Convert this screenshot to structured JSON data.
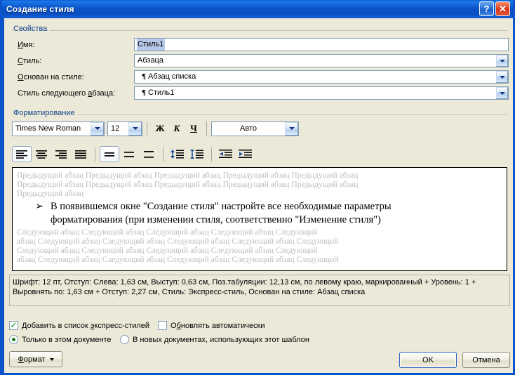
{
  "window": {
    "title": "Создание стиля",
    "help_button": "?",
    "close_button": "✕"
  },
  "properties": {
    "group_label": "Свойства",
    "name_label": "Имя:",
    "name_value": "Стиль1",
    "style_type_label": "Стиль:",
    "style_type_value": "Абзаца",
    "based_on_label": "Основан на стиле:",
    "based_on_value": "Абзац списка",
    "next_style_label": "Стиль следующего абзаца:",
    "next_style_value": "Стиль1",
    "pilcrow": "¶"
  },
  "formatting": {
    "group_label": "Форматирование",
    "font_name": "Times New Roman",
    "font_size": "12",
    "bold_label": "Ж",
    "italic_label": "К",
    "underline_label": "Ч",
    "color_value": "Авто",
    "align_left": "align-left",
    "align_center": "align-center",
    "align_right": "align-right",
    "align_justify": "align-justify",
    "spacing_single": "line-spacing-single",
    "spacing_onehalf": "line-spacing-1.5",
    "spacing_double": "line-spacing-double",
    "space_before": "decrease-paragraph-spacing",
    "space_after": "increase-paragraph-spacing",
    "indent_decrease": "decrease-indent",
    "indent_increase": "increase-indent"
  },
  "preview": {
    "prev_line_1": "Предыдущий абзац Предыдущий абзац Предыдущий абзац Предыдущий абзац Предыдущий абзац",
    "prev_line_2": "Предыдущий абзац Предыдущий абзац Предыдущий абзац Предыдущий абзац Предыдущий абзац",
    "prev_line_3": "Предыдущий абзац",
    "bullet": "➢",
    "sample_line_1": "В появившемся окне \"Создание стиля\" настройте все необходимые параметры",
    "sample_line_2": "форматирования (при изменении стиля, соответственно \"Изменение стиля\")",
    "next_line_1": "Следующий абзац Следующий абзац Следующий абзац Следующий абзац Следующий",
    "next_line_2": "абзац Следующий абзац Следующий абзац Следующий абзац Следующий абзац Следующий",
    "next_line_3": "Следующий абзац Следующий абзац Следующий абзац Следующий абзац Следующий",
    "next_line_4": "абзац Следующий абзац Следующий абзац Следующий абзац Следующий абзац Следующий"
  },
  "description": {
    "line_1": "Шрифт: 12 пт, Отступ: Слева:  1,63 см, Выступ:  0,63 см, Поз.табуляции:  12,13 см, по левому краю, маркированный + Уровень: 1 +",
    "line_2": "Выровнять по:  1,63 см + Отступ:  2,27 см, Стиль: Экспресс-стиль, Основан на стиле: Абзац списка"
  },
  "options": {
    "add_to_quick_styles": "Добавить в список экспресс-стилей",
    "add_to_quick_styles_checked": true,
    "auto_update": "Обновлять автоматически",
    "auto_update_checked": false,
    "only_this_document": "Только в этом документе",
    "only_this_document_selected": true,
    "new_documents": "В новых документах, использующих этот шаблон",
    "new_documents_selected": false
  },
  "buttons": {
    "format": "Формат",
    "ok": "OK",
    "cancel": "Отмена"
  },
  "colors": {
    "titlebar": "#0a54c8",
    "dialog_bg": "#ece9d8",
    "group_label": "#0b3f8c",
    "selection": "#b8c8e8",
    "check_green": "#0a8a22"
  }
}
